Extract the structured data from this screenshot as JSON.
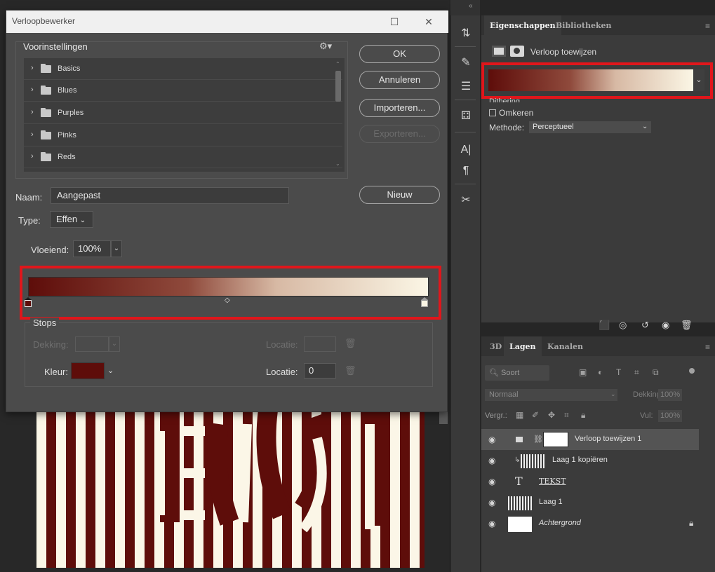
{
  "dialog": {
    "title": "Verloopbewerker",
    "presets_title": "Voorinstellingen",
    "presets": [
      "Basics",
      "Blues",
      "Purples",
      "Pinks",
      "Reds"
    ],
    "buttons": {
      "ok": "OK",
      "cancel": "Annuleren",
      "import": "Importeren...",
      "export": "Exporteren...",
      "new": "Nieuw"
    },
    "name_label": "Naam:",
    "name_value": "Aangepast",
    "type_label": "Type:",
    "type_value": "Effen",
    "smoothness_label": "Vloeiend:",
    "smoothness_value": "100%",
    "stops_title": "Stops",
    "opacity_label": "Dekking:",
    "location_label": "Locatie:",
    "color_label": "Kleur:",
    "location_value": "0",
    "gradient_colors": [
      "#5e0d0a",
      "#fbf6e5"
    ]
  },
  "properties": {
    "tabs": [
      "Eigenschappen",
      "Bibliotheken"
    ],
    "adjustment_title": "Verloop toewijzen",
    "dither_label": "Dithering",
    "reverse_label": "Omkeren",
    "method_label": "Methode:",
    "method_value": "Perceptueel"
  },
  "layers": {
    "tabs": [
      "3D",
      "Lagen",
      "Kanalen"
    ],
    "kind_placeholder": "Soort",
    "blend_mode": "Normaal",
    "opacity_label": "Dekking:",
    "opacity_value": "100%",
    "lock_label": "Vergr.:",
    "fill_label": "Vul:",
    "fill_value": "100%",
    "items": [
      {
        "name": "Verloop toewijzen 1",
        "selected": true
      },
      {
        "name": "Laag 1 kopiëren"
      },
      {
        "name": "TEKST"
      },
      {
        "name": "Laag 1"
      },
      {
        "name": "Achtergrond"
      }
    ]
  },
  "canvas": {
    "text": "TEKST"
  },
  "accent": {
    "highlight": "#e0161b",
    "dark_red": "#5e0d0a",
    "cream": "#fbf6e5"
  }
}
